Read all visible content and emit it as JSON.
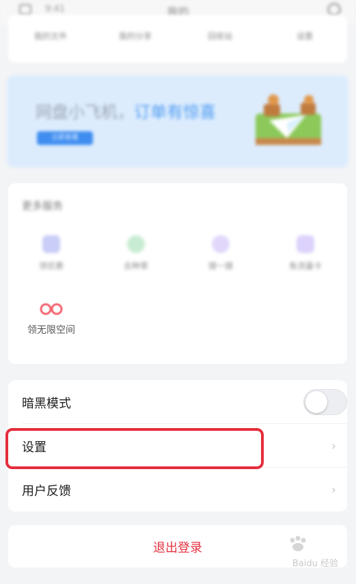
{
  "topbar": {
    "left_text": "9:41",
    "title": "我的",
    "icons": [
      "menu-icon",
      "settings-icon"
    ]
  },
  "shortcuts": [
    "我的文件",
    "我的分享",
    "回收站",
    "设置"
  ],
  "banner": {
    "headline_prefix": "网盘小飞机",
    "headline_accent": "订单有惊喜",
    "pill": "立即查看",
    "colors": {
      "background": "#dcecfd",
      "accent": "#4f9bf2"
    }
  },
  "services": {
    "title": "更多服务",
    "items": [
      {
        "label": "领优惠",
        "icon": "coupon-icon",
        "color": "#c9cdf7"
      },
      {
        "label": "去种草",
        "icon": "leaf-icon",
        "color": "#c8ecd3"
      },
      {
        "label": "搜一搜",
        "icon": "search-icon",
        "color": "#e1d7fb"
      },
      {
        "label": "免流量卡",
        "icon": "sim-card-icon",
        "color": "#dcd2fb"
      },
      {
        "label": "领无限空间",
        "icon": "infinity-icon",
        "color": "#f2636f"
      }
    ]
  },
  "settings": {
    "dark_mode": {
      "label": "暗黑模式",
      "enabled": false
    },
    "settings_item": {
      "label": "设置"
    },
    "feedback_item": {
      "label": "用户反馈"
    }
  },
  "logout": {
    "label": "退出登录",
    "color": "#e5323f"
  },
  "watermark": {
    "text": "Baidu 经验"
  }
}
